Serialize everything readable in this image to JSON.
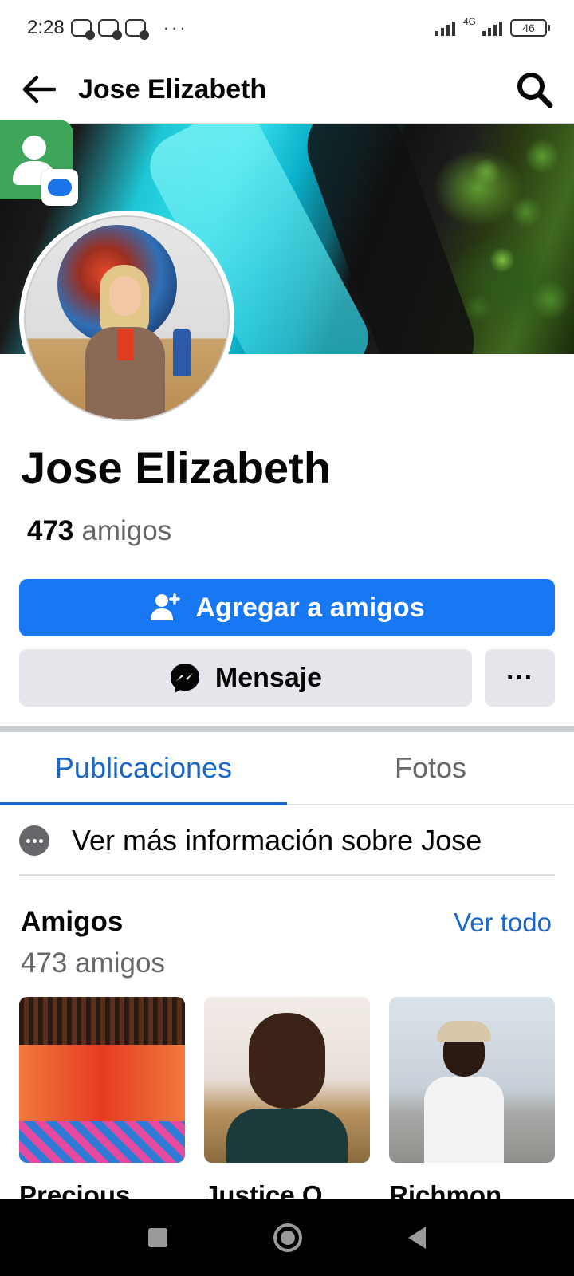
{
  "status_bar": {
    "time": "2:28",
    "dots": "···",
    "network": "4G",
    "battery": "46"
  },
  "header": {
    "title": "Jose Elizabeth"
  },
  "profile": {
    "name": "Jose Elizabeth",
    "friends_count": "473",
    "friends_word": "amigos"
  },
  "actions": {
    "add_friend": "Agregar a amigos",
    "message": "Mensaje",
    "more": "···"
  },
  "tabs": [
    {
      "label": "Publicaciones",
      "active": true
    },
    {
      "label": "Fotos",
      "active": false
    }
  ],
  "info": {
    "text": "Ver más información sobre Jose"
  },
  "friends_section": {
    "heading": "Amigos",
    "see_all": "Ver todo",
    "count": "473 amigos",
    "items": [
      {
        "name": "Precious"
      },
      {
        "name": "Justice O"
      },
      {
        "name": "Richmon"
      }
    ]
  },
  "colors": {
    "primary_blue": "#1877f2",
    "tab_active": "#1b66c9",
    "secondary_button": "#e4e6eb"
  },
  "icons": {
    "back": "arrow-left-icon",
    "search": "search-icon",
    "add_friend": "person-plus-icon",
    "messenger": "messenger-icon",
    "info": "more-circle-icon"
  }
}
